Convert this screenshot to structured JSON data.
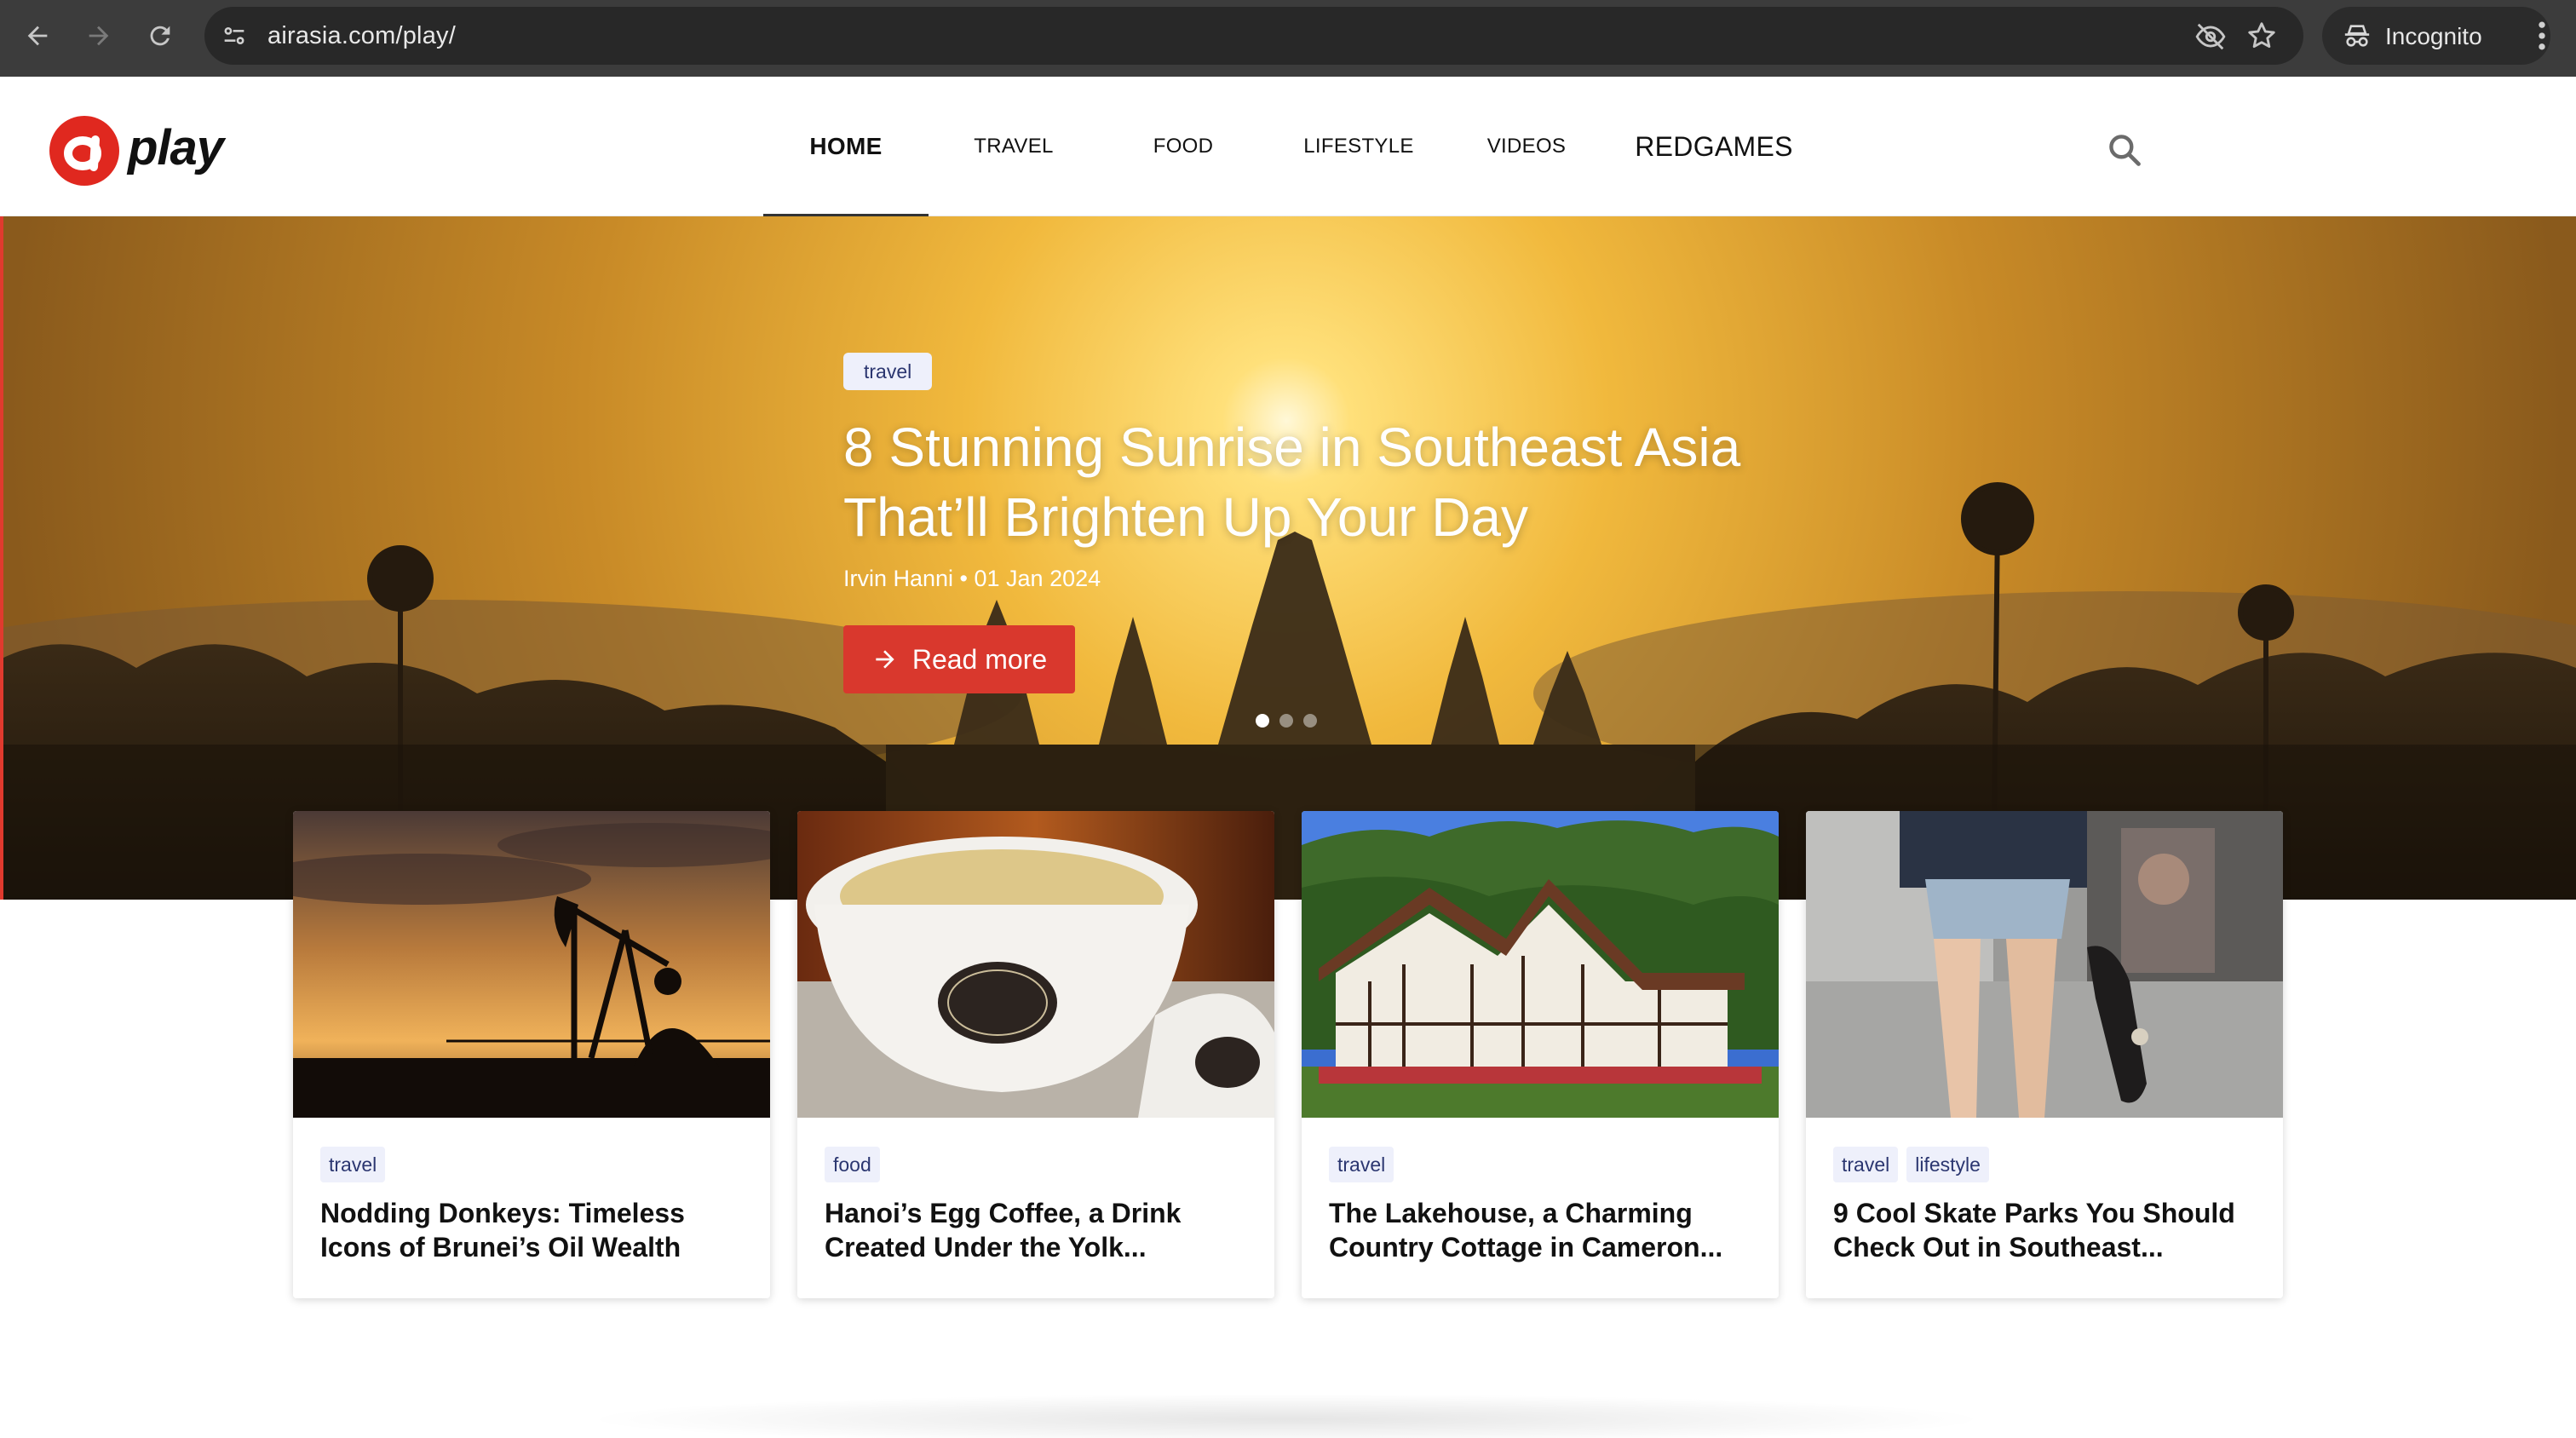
{
  "browser": {
    "url": "airasia.com/play/",
    "incognito_label": "Incognito"
  },
  "site": {
    "logo_word": "play",
    "nav": [
      {
        "label": "HOME",
        "active": true
      },
      {
        "label": "TRAVEL"
      },
      {
        "label": "FOOD"
      },
      {
        "label": "LIFESTYLE"
      },
      {
        "label": "VIDEOS"
      },
      {
        "label": "REDGAMES"
      }
    ],
    "brand_color": "#e03a2e"
  },
  "hero": {
    "tag": "travel",
    "title": "8 Stunning Sunrise in Southeast Asia That’ll Brighten Up Your Day",
    "byline": "Irvin Hanni • 01 Jan 2024",
    "cta": "Read more",
    "slides": 3,
    "active_slide": 1
  },
  "cards": [
    {
      "tags": [
        "travel"
      ],
      "title": "Nodding Donkeys: Timeless Icons of Brunei’s Oil Wealth"
    },
    {
      "tags": [
        "food"
      ],
      "title": "Hanoi’s Egg Coffee, a Drink Created Under the Yolk..."
    },
    {
      "tags": [
        "travel"
      ],
      "title": "The Lakehouse, a Charming Country Cottage in Cameron..."
    },
    {
      "tags": [
        "travel",
        "lifestyle"
      ],
      "title": "9 Cool Skate Parks You Should Check Out in Southeast..."
    }
  ]
}
